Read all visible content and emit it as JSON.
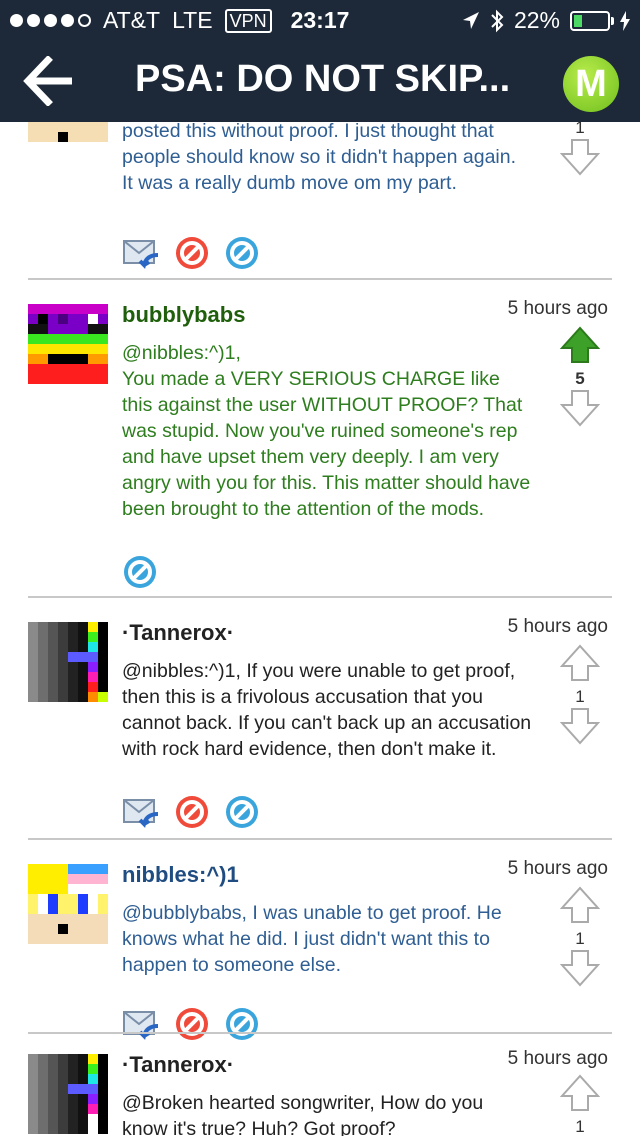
{
  "status": {
    "carrier": "AT&T",
    "network": "LTE",
    "vpn": "VPN",
    "time": "23:17",
    "battery": "22%",
    "battery_level": 0.22
  },
  "nav": {
    "title": "PSA: DO NOT SKIP...",
    "logo_letter": "M"
  },
  "comments": [
    {
      "author": "",
      "time": "",
      "body": "posted this without proof. I just thought that people should know so it didn't happen again. It was a really dumb move om my part.",
      "votes": "1"
    },
    {
      "author": "bubblybabs",
      "time": "5 hours ago",
      "body": "@nibbles:^)1,\nYou made a VERY SERIOUS CHARGE like this against the user WITHOUT PROOF? That was stupid. Now you've ruined someone's rep and have upset them very deeply. I am very angry with you for this. This matter should have been brought to the attention of the mods.",
      "votes": "5"
    },
    {
      "author": "·Tannerox·",
      "time": "5 hours ago",
      "body": "@nibbles:^)1, If you were unable to get proof, then this is a frivolous accusation that you cannot back. If you can't back up an accusation with rock hard evidence, then don't make it.",
      "votes": "1"
    },
    {
      "author": "nibbles:^)1",
      "time": "5 hours ago",
      "body": "@bubblybabs, I was unable to get proof. He knows what he did. I just didn't want this to happen to someone else.",
      "votes": "1"
    },
    {
      "author": "·Tannerox·",
      "time": "5 hours ago",
      "body": "@Broken hearted songwriter, How do you know it's true? Huh? Got proof?",
      "votes": "1"
    }
  ]
}
